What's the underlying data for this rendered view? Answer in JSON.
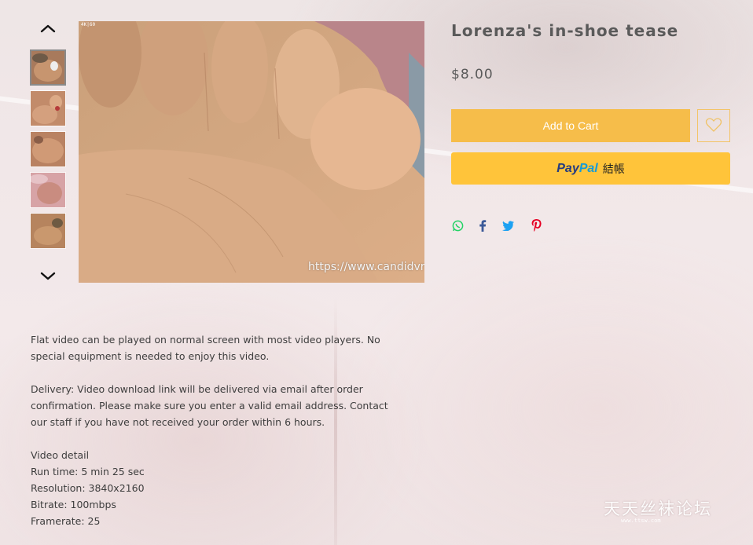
{
  "gallery": {
    "up_icon": "chevron-up-icon",
    "down_icon": "chevron-down-icon",
    "thumbnails": [
      {
        "tone": "#b07d60",
        "active": true
      },
      {
        "tone": "#c58f6d"
      },
      {
        "tone": "#c48a68"
      },
      {
        "tone": "#d9a7a8"
      },
      {
        "tone": "#b8865e"
      }
    ],
    "main_image": {
      "watermark_url": "https://www.candidvri",
      "corner_tag": "4K|60"
    }
  },
  "product": {
    "title": "Lorenza's in-shoe tease",
    "price": "$8.00",
    "add_to_cart_label": "Add to Cart",
    "wishlist_icon": "heart-icon",
    "paypal": {
      "pay": "Pay",
      "pal": "Pal",
      "suffix": "結帳"
    },
    "share_icons": [
      "whatsapp-icon",
      "facebook-icon",
      "twitter-icon",
      "pinterest-icon"
    ]
  },
  "description": {
    "para1": [
      "Flat video can be played on normal screen with most video players. No",
      "special equipment is needed to enjoy this video."
    ],
    "para2": [
      "Delivery: Video download link will be delivered via email after order",
      "confirmation. Please make sure you enter a valid email address. Contact",
      "our staff if you have not received your order within 6 hours."
    ],
    "detail": [
      "Video detail",
      "Run time:  5 min 25 sec",
      "Resolution: 3840x2160",
      "Bitrate: 100mbps",
      "Framerate: 25"
    ]
  },
  "watermark": {
    "text": "天天丝袜论坛",
    "sub": "www.ttsw.com"
  },
  "colors": {
    "accent": "#f6bd4a",
    "paypal": "#ffc43a",
    "whatsapp": "#25d366",
    "facebook": "#3b5998",
    "twitter": "#1da1f2",
    "pinterest": "#e60023"
  }
}
